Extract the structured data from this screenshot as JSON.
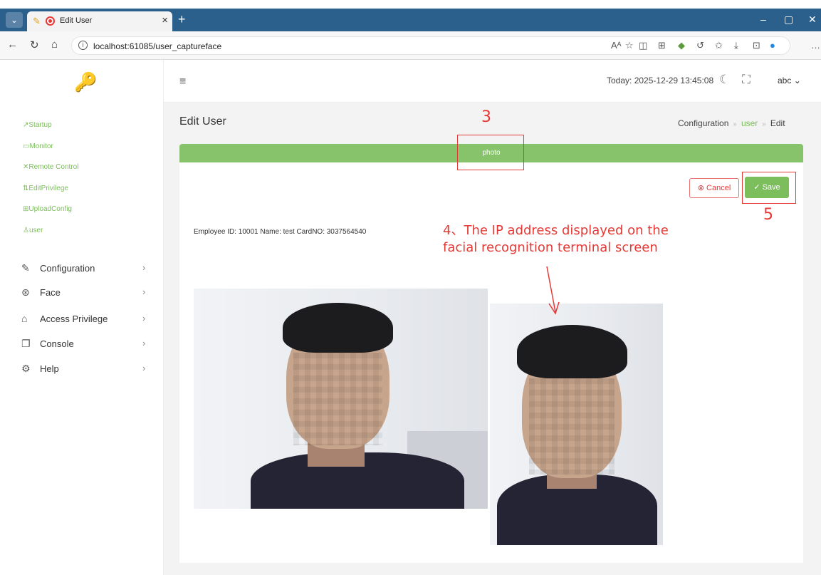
{
  "browser": {
    "tab_title": "Edit User",
    "url": "localhost:61085/user_captureface"
  },
  "sidebar": {
    "sub_items": [
      {
        "label": "Startup",
        "icon": "path-icon"
      },
      {
        "label": "Monitor",
        "icon": "monitor-icon"
      },
      {
        "label": "Remote Control",
        "icon": "remote-icon"
      },
      {
        "label": "EditPrivilege",
        "icon": "privilege-icon"
      },
      {
        "label": "UploadConfig",
        "icon": "upload-icon"
      },
      {
        "label": "user",
        "icon": "user-icon"
      }
    ],
    "menu": [
      {
        "label": "Configuration",
        "icon": "pencil-icon"
      },
      {
        "label": "Face",
        "icon": "aperture-icon"
      },
      {
        "label": "Access Privilege",
        "icon": "home-icon"
      },
      {
        "label": "Console",
        "icon": "window-icon"
      },
      {
        "label": "Help",
        "icon": "gear-icon"
      }
    ]
  },
  "header": {
    "today_label": "Today: ",
    "today_value": "2025-12-29 13:45:08",
    "user": "abc"
  },
  "page": {
    "title": "Edit User",
    "breadcrumb": [
      "Configuration",
      "user",
      "Edit"
    ],
    "section_bar": "photo",
    "cancel_label": "Cancel",
    "save_label": "Save",
    "employee_info": "Employee ID: 10001 Name: test CardNO: 3037564540"
  },
  "annotations": {
    "n3": "3",
    "n5": "5",
    "note4_line1": "4、The IP address displayed on the",
    "note4_line2": "facial recognition terminal screen"
  },
  "colors": {
    "tabbar": "#2b5f8c",
    "accent_green": "#7cbd5c",
    "cancel_red": "#e53935",
    "annotation_red": "#e53935"
  }
}
